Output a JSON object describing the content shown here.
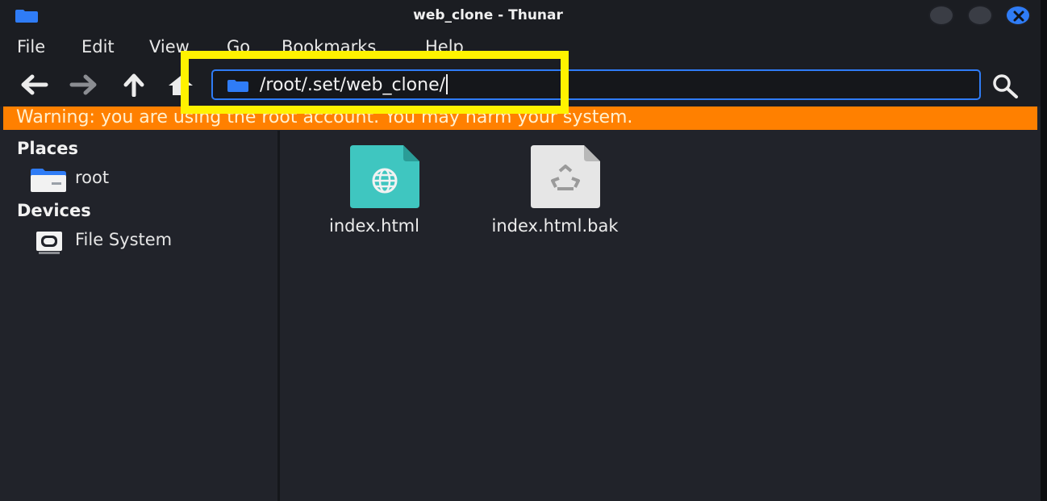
{
  "window": {
    "title": "web_clone - Thunar",
    "title_icon": "folder-icon",
    "controls": [
      "minimize-button",
      "maximize-button",
      "close-button"
    ],
    "accent_color": "#2f7cf6"
  },
  "menu": {
    "items": [
      "File",
      "Edit",
      "View",
      "Go",
      "Bookmarks",
      "Help"
    ]
  },
  "toolbar": {
    "back_icon": "arrow-left-icon",
    "forward_icon": "arrow-right-icon",
    "up_icon": "arrow-up-icon",
    "home_icon": "home-icon",
    "location_value": "/root/.set/web_clone/",
    "search_icon": "search-icon"
  },
  "warning": {
    "text": "Warning: you are using the root account. You may harm your system.",
    "color": "#ff8000"
  },
  "sidebar": {
    "places_heading": "Places",
    "places": [
      {
        "label": "root",
        "icon": "home-folder-icon"
      }
    ],
    "devices_heading": "Devices",
    "devices": [
      {
        "label": "File System",
        "icon": "drive-icon"
      }
    ]
  },
  "files": [
    {
      "name": "index.html",
      "icon": "html-file-icon",
      "color": "#3fc6c0"
    },
    {
      "name": "index.html.bak",
      "icon": "backup-file-icon",
      "color": "#e6e6e6"
    }
  ],
  "annotation": {
    "highlight_color": "#fff200"
  }
}
